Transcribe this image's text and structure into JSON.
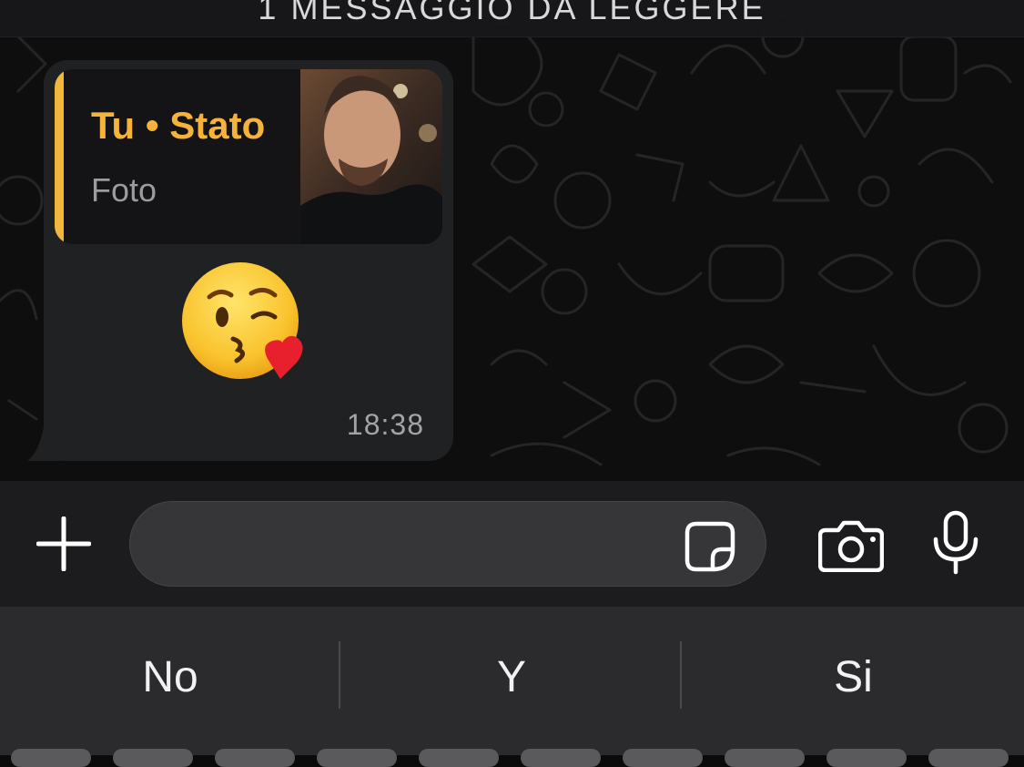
{
  "chat": {
    "unread_banner": "1 MESSAGGIO DA LEGGERE"
  },
  "message": {
    "quote_title": "Tu • Stato",
    "quote_subtitle": "Foto",
    "emoji": "kissing-face-with-heart",
    "time": "18:38"
  },
  "input": {
    "placeholder": ""
  },
  "keyboard": {
    "suggestions": [
      "No",
      "Y",
      "Si"
    ]
  },
  "colors": {
    "accent": "#f5b33b",
    "bubble": "#202123",
    "input_bar": "#1c1c1e",
    "keyboard": "#2b2b2d"
  }
}
